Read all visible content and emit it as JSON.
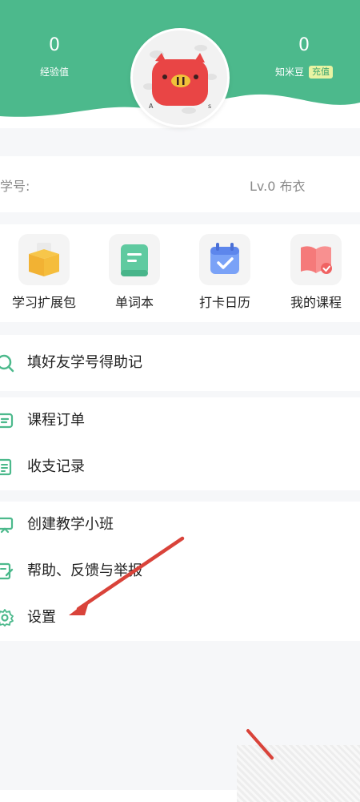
{
  "stats": {
    "exp": {
      "value": "0",
      "label": "经验值"
    },
    "beans": {
      "value": "0",
      "label": "知米豆",
      "recharge": "充值"
    }
  },
  "profile": {
    "student_id_label": "学号:",
    "level": "Lv.0 布衣"
  },
  "shortcuts": [
    {
      "label": "学习扩展包",
      "icon": "box-icon"
    },
    {
      "label": "单词本",
      "icon": "scroll-icon"
    },
    {
      "label": "打卡日历",
      "icon": "calendar-icon"
    },
    {
      "label": "我的课程",
      "icon": "book-icon"
    }
  ],
  "menu": {
    "group1": [
      {
        "label": "填好友学号得助记",
        "icon": "search-icon"
      }
    ],
    "group2": [
      {
        "label": "课程订单",
        "icon": "order-icon"
      },
      {
        "label": "收支记录",
        "icon": "record-icon"
      }
    ],
    "group3": [
      {
        "label": "创建教学小班",
        "icon": "class-icon"
      },
      {
        "label": "帮助、反馈与举报",
        "icon": "feedback-icon"
      },
      {
        "label": "设置",
        "icon": "gear-icon"
      }
    ]
  },
  "colors": {
    "accent": "#4cb98c",
    "annotation_arrow": "#d9433a"
  }
}
